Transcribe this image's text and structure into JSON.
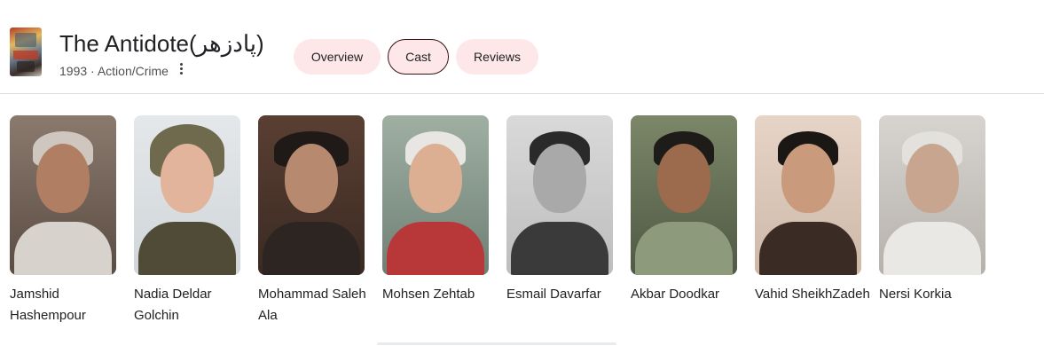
{
  "movie": {
    "title": "The Antidote(پادزهر)",
    "subtitle": "1993 · Action/Crime"
  },
  "tabs": [
    {
      "label": "Overview",
      "active": false
    },
    {
      "label": "Cast",
      "active": true
    },
    {
      "label": "Reviews",
      "active": false
    }
  ],
  "cast": [
    {
      "name": "Jamshid Hashempour"
    },
    {
      "name": "Nadia Deldar Golchin"
    },
    {
      "name": "Mohammad Saleh Ala"
    },
    {
      "name": "Mohsen Zehtab"
    },
    {
      "name": "Esmail Davarfar"
    },
    {
      "name": "Akbar Doodkar"
    },
    {
      "name": "Vahid SheikhZadeh"
    },
    {
      "name": "Nersi Korkia"
    }
  ],
  "colors": {
    "tab_bg": "#fde7e9",
    "tab_active_border": "#3c1017",
    "divider": "#dadce0"
  }
}
